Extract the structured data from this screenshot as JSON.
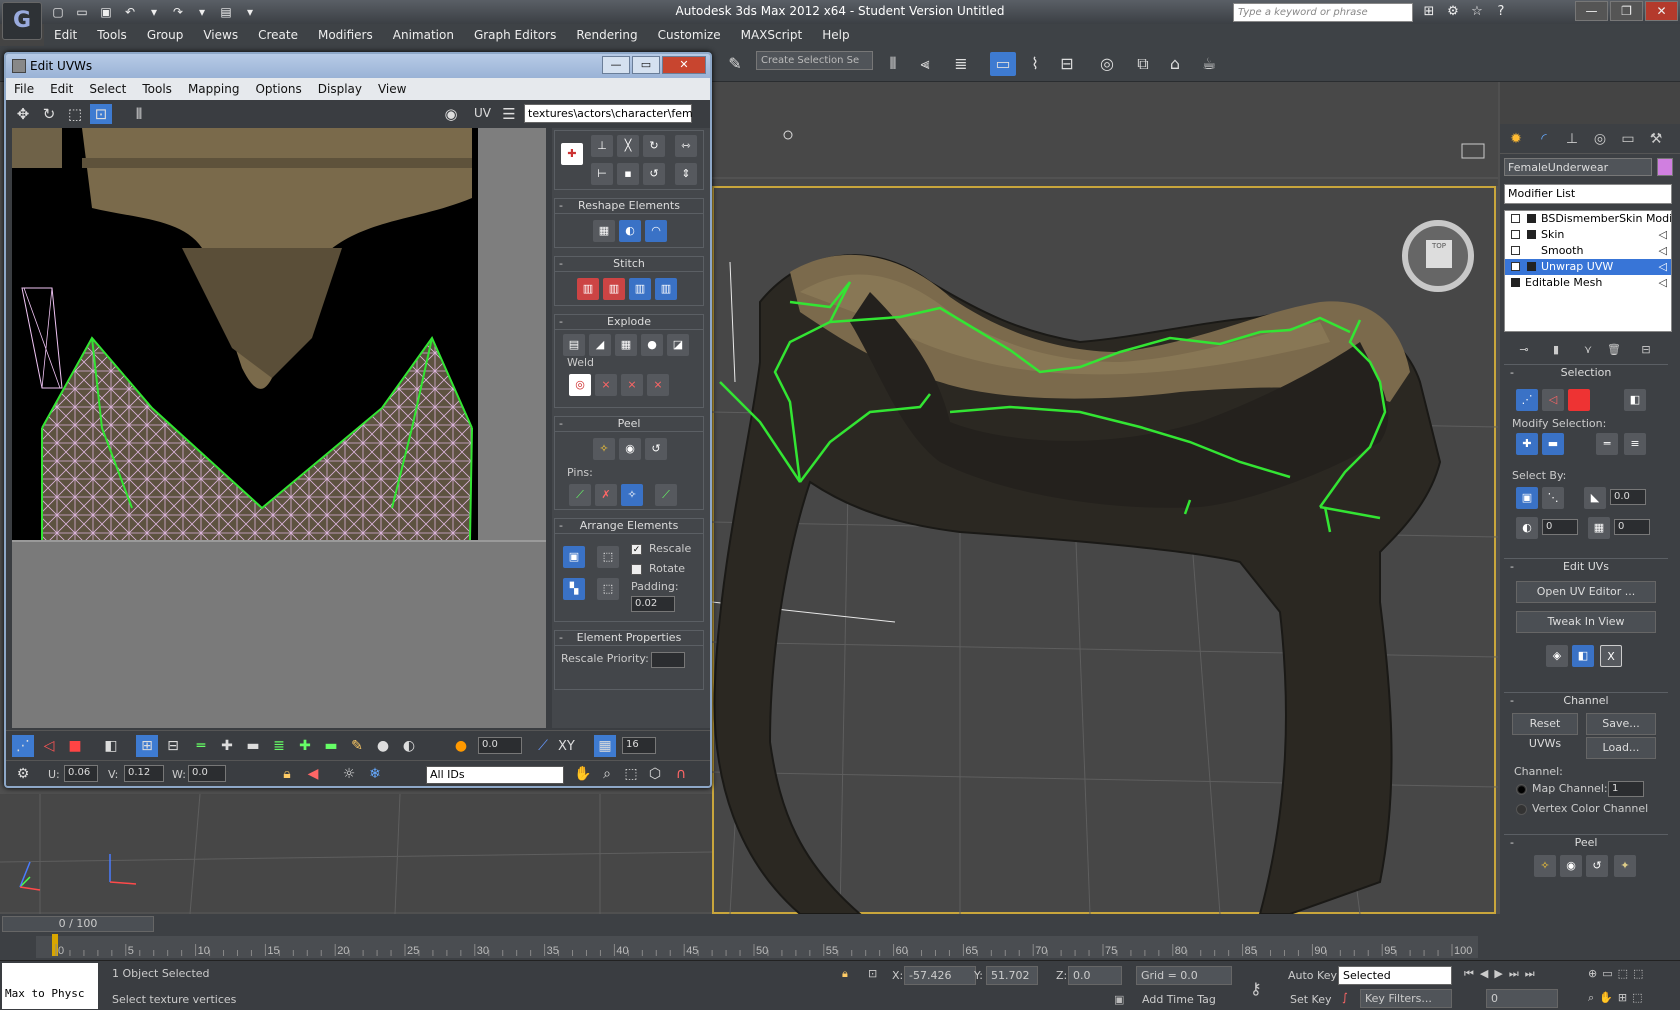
{
  "app": {
    "title": "Autodesk 3ds Max  2012 x64  - Student Version   Untitled",
    "search_placeholder": "Type a keyword or phrase"
  },
  "menu": [
    "Edit",
    "Tools",
    "Group",
    "Views",
    "Create",
    "Modifiers",
    "Animation",
    "Graph Editors",
    "Rendering",
    "Customize",
    "MAXScript",
    "Help"
  ],
  "toolbar": {
    "selection_set_placeholder": "Create Selection Se"
  },
  "uvw_window": {
    "title": "Edit UVWs",
    "menu": [
      "File",
      "Edit",
      "Select",
      "Tools",
      "Mapping",
      "Options",
      "Display",
      "View"
    ],
    "uv_label": "UV",
    "texture_path": "textures\\actors\\character\\fem",
    "rollouts": {
      "reshape": "Reshape Elements",
      "stitch": "Stitch",
      "explode": "Explode",
      "weld": "Weld",
      "peel": "Peel",
      "pins": "Pins:",
      "arrange": "Arrange Elements",
      "rescale": "Rescale",
      "rescale_checked": true,
      "rotate": "Rotate",
      "rotate_checked": false,
      "padding_label": "Padding:",
      "padding_value": "0.02",
      "element_props": "Element Properties",
      "rescale_priority": "Rescale Priority:"
    },
    "bottom": {
      "spinner_value": "0.0",
      "xy_label": "XY",
      "grid_value": "16",
      "u_label": "U:",
      "u_value": "0.06",
      "v_label": "V:",
      "v_value": "0.12",
      "w_label": "W:",
      "w_value": "0.0",
      "ids_select": "All IDs"
    }
  },
  "command_panel": {
    "object_name": "FemaleUnderwear",
    "object_color": "#d07fe0",
    "modifier_list": "Modifier List",
    "stack": [
      {
        "label": "BSDismemberSkin Modifier",
        "selected": false
      },
      {
        "label": "Skin",
        "selected": false
      },
      {
        "label": "Smooth",
        "selected": false
      },
      {
        "label": "Unwrap UVW",
        "selected": true
      },
      {
        "label": "Editable Mesh",
        "selected": false
      }
    ],
    "selection": {
      "title": "Selection",
      "modify_selection": "Modify Selection:",
      "select_by": "Select By:",
      "spin1": "0.0",
      "spin2": "0",
      "spin3": "0"
    },
    "edit_uvs": {
      "title": "Edit UVs",
      "open_editor": "Open UV Editor ...",
      "tweak": "Tweak In View"
    },
    "channel": {
      "title": "Channel",
      "reset": "Reset UVWs",
      "save": "Save...",
      "load": "Load...",
      "channel_label": "Channel:",
      "map_channel": "Map Channel:",
      "map_channel_value": "1",
      "vertex_color": "Vertex Color Channel"
    },
    "peel_title": "Peel"
  },
  "timeline": {
    "slider_text": "0 / 100",
    "ticks": [
      "0",
      "5",
      "10",
      "15",
      "20",
      "25",
      "30",
      "35",
      "40",
      "45",
      "50",
      "55",
      "60",
      "65",
      "70",
      "75",
      "80",
      "85",
      "90",
      "95",
      "100"
    ]
  },
  "status": {
    "listener_text": "Max to Physc",
    "selected": "1 Object Selected",
    "prompt": "Select texture vertices",
    "x_label": "X:",
    "x_value": "-57.426",
    "y_label": "Y:",
    "y_value": "51.702",
    "z_label": "Z:",
    "z_value": "0.0",
    "grid": "Grid = 0.0",
    "add_time_tag": "Add Time Tag",
    "auto_key": "Auto Key",
    "set_key": "Set Key",
    "selected_dropdown": "Selected",
    "key_filters": "Key Filters...",
    "frame": "0"
  },
  "colors": {
    "accent": "#3e7bd1",
    "seam": "#33e533",
    "viewport_border": "#c9a63c"
  }
}
